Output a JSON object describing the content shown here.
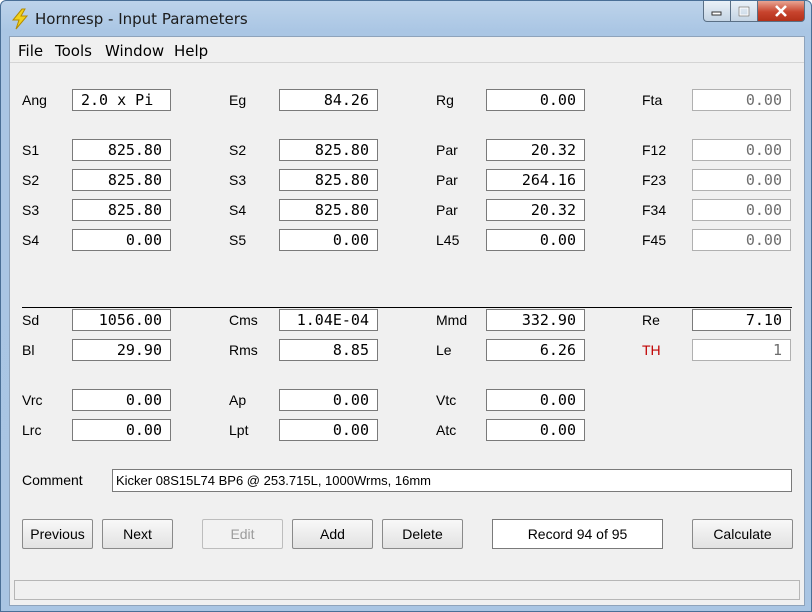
{
  "window": {
    "title": "Hornresp - Input Parameters"
  },
  "menu": [
    "File",
    "Tools",
    "Window",
    "Help"
  ],
  "rows": {
    "r1": [
      {
        "label": "Ang",
        "value": "2.0 x Pi"
      },
      {
        "label": "Eg",
        "value": "84.26"
      },
      {
        "label": "Rg",
        "value": "0.00"
      },
      {
        "label": "Fta",
        "value": "0.00"
      }
    ],
    "r2": [
      {
        "label": "S1",
        "value": "825.80"
      },
      {
        "label": "S2",
        "value": "825.80"
      },
      {
        "label": "Par",
        "value": "20.32"
      },
      {
        "label": "F12",
        "value": "0.00"
      }
    ],
    "r3": [
      {
        "label": "S2",
        "value": "825.80"
      },
      {
        "label": "S3",
        "value": "825.80"
      },
      {
        "label": "Par",
        "value": "264.16"
      },
      {
        "label": "F23",
        "value": "0.00"
      }
    ],
    "r4": [
      {
        "label": "S3",
        "value": "825.80"
      },
      {
        "label": "S4",
        "value": "825.80"
      },
      {
        "label": "Par",
        "value": "20.32"
      },
      {
        "label": "F34",
        "value": "0.00"
      }
    ],
    "r5": [
      {
        "label": "S4",
        "value": "0.00"
      },
      {
        "label": "S5",
        "value": "0.00"
      },
      {
        "label": "L45",
        "value": "0.00"
      },
      {
        "label": "F45",
        "value": "0.00"
      }
    ],
    "r6": [
      {
        "label": "Sd",
        "value": "1056.00"
      },
      {
        "label": "Cms",
        "value": "1.04E-04"
      },
      {
        "label": "Mmd",
        "value": "332.90"
      },
      {
        "label": "Re",
        "value": "7.10"
      }
    ],
    "r7": [
      {
        "label": "Bl",
        "value": "29.90"
      },
      {
        "label": "Rms",
        "value": "8.85"
      },
      {
        "label": "Le",
        "value": "6.26"
      },
      {
        "label": "TH",
        "value": "1"
      }
    ],
    "r8": [
      {
        "label": "Vrc",
        "value": "0.00"
      },
      {
        "label": "Ap",
        "value": "0.00"
      },
      {
        "label": "Vtc",
        "value": "0.00"
      }
    ],
    "r9": [
      {
        "label": "Lrc",
        "value": "0.00"
      },
      {
        "label": "Lpt",
        "value": "0.00"
      },
      {
        "label": "Atc",
        "value": "0.00"
      }
    ]
  },
  "comment": {
    "label": "Comment",
    "value": "Kicker 08S15L74 BP6 @ 253.715L, 1000Wrms, 16mm"
  },
  "buttons": {
    "previous": "Previous",
    "next": "Next",
    "edit": "Edit",
    "add": "Add",
    "delete": "Delete",
    "calculate": "Calculate"
  },
  "record": "Record 94 of 95",
  "colors": {
    "th_label": "#c00000",
    "disabled_text": "#6d6d6d"
  }
}
